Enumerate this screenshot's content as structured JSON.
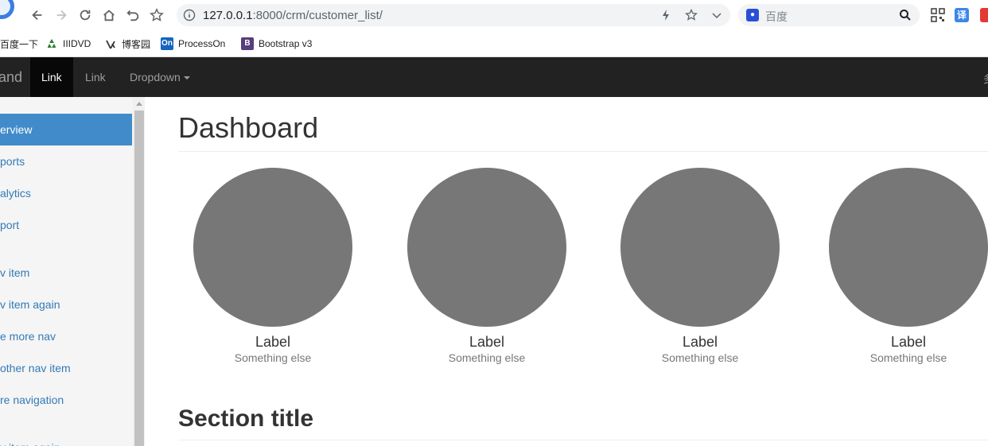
{
  "browser": {
    "url_host": "127.0.0.1",
    "url_rest": ":8000/crm/customer_list/",
    "search_placeholder": "百度",
    "translate_label": "译"
  },
  "bookmarks": [
    {
      "label": "百度一下",
      "icon": "baidu-icon"
    },
    {
      "label": "IIIDVD",
      "icon": "recycle-icon",
      "color": "#2e7d32"
    },
    {
      "label": "博客园",
      "icon": "cnblogs-icon",
      "color": "#333333"
    },
    {
      "label": "ProcessOn",
      "icon": "processon-icon",
      "icon_text": "On",
      "color": "#1565c0"
    },
    {
      "label": "Bootstrap v3",
      "icon": "bootstrap-icon",
      "icon_text": "B",
      "color": "#563d7c"
    }
  ],
  "navbar": {
    "brand": "and",
    "items": [
      {
        "label": "Link",
        "active": true
      },
      {
        "label": "Link",
        "active": false
      },
      {
        "label": "Dropdown",
        "active": false,
        "dropdown": true
      }
    ],
    "right_text": "多"
  },
  "sidebar": {
    "items": [
      {
        "label": "erview",
        "active": true
      },
      {
        "label": "ports"
      },
      {
        "label": "alytics"
      },
      {
        "label": "port"
      },
      {
        "label": "v item"
      },
      {
        "label": "v item again"
      },
      {
        "label": "e more nav"
      },
      {
        "label": "other nav item"
      },
      {
        "label": "re navigation"
      },
      {
        "label": "v item again"
      }
    ]
  },
  "main": {
    "title": "Dashboard",
    "placeholders": [
      {
        "label": "Label",
        "sub": "Something else"
      },
      {
        "label": "Label",
        "sub": "Something else"
      },
      {
        "label": "Label",
        "sub": "Something else"
      },
      {
        "label": "Label",
        "sub": "Something else"
      }
    ],
    "section_title": "Section title"
  },
  "colors": {
    "navbar_bg": "#222222",
    "active_nav": "#080808",
    "sidebar_active": "#428bca",
    "link": "#337ab7",
    "placeholder_circle": "#777777"
  }
}
